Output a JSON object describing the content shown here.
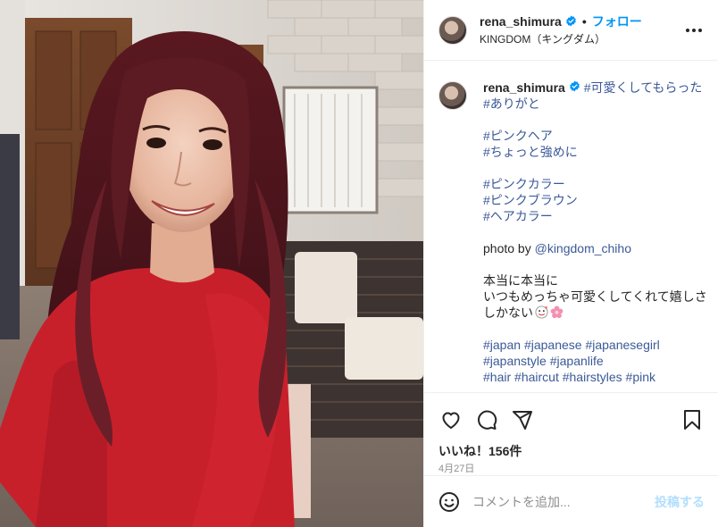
{
  "post": {
    "username": "rena_shimura",
    "verified": true,
    "follow_label": "フォロー",
    "dot": "•",
    "location": "KINGDOM（キングダム）",
    "more_icon": "more-options-icon",
    "more_label": "•••"
  },
  "caption": {
    "username": "rena_shimura",
    "para1": {
      "line1": "#可愛くしてもらった",
      "line2": "#ありがと"
    },
    "para2": {
      "line1": "#ピンクヘア",
      "line2": "#ちょっと強めに"
    },
    "para3": {
      "line1": "#ピンクカラー",
      "line2": "#ピンクブラウン",
      "line3": "#ヘアカラー"
    },
    "photo_by_prefix": "photo by ",
    "photo_by_mention": "@kingdom_chiho",
    "para5": {
      "line1": "本当に本当に",
      "line2": "いつもめっちゃ可愛くしてくれて嬉しさ",
      "line3": "しかない"
    },
    "tags": {
      "t1": "#japan",
      "t2": "#japanese",
      "t3": "#japanesegirl",
      "t4": "#japanstyle",
      "t5": "#japanlife",
      "t6": "#hair",
      "t7": "#haircut",
      "t8": "#hairstyles",
      "t9": "#pink"
    }
  },
  "actions": {
    "like_icon": "heart-icon",
    "comment_icon": "comment-icon",
    "share_icon": "share-icon",
    "save_icon": "bookmark-icon",
    "likes_text": "いいね！156件",
    "date_text": "4月27日"
  },
  "comment": {
    "placeholder": "コメントを追加...",
    "post_label": "投稿する",
    "emoji_icon": "smiley-icon"
  },
  "colors": {
    "accent": "#0095f6",
    "hashtag": "#3b5998",
    "verified": "#0095f6",
    "sweater": "#c8202b",
    "hair": "#5a1b22"
  }
}
